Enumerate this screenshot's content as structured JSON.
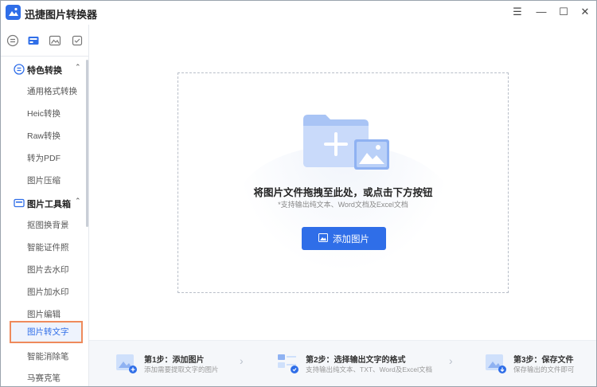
{
  "app": {
    "title": "迅捷图片转换器"
  },
  "window_controls": {
    "menu": "☰",
    "minimize": "—",
    "maximize": "☐",
    "close": "✕"
  },
  "sidebar": {
    "groups": [
      {
        "label": "特色转换",
        "icon": "special-convert-icon",
        "items": [
          "通用格式转换",
          "Heic转换",
          "Raw转换",
          "转为PDF",
          "图片压缩"
        ]
      },
      {
        "label": "图片工具箱",
        "icon": "toolbox-icon",
        "items": [
          "抠图换背景",
          "智能证件照",
          "图片去水印",
          "图片加水印",
          "图片编辑",
          "图片转文字",
          "智能消除笔",
          "马赛克笔"
        ]
      }
    ],
    "active_item": "图片转文字",
    "caret": "⌃"
  },
  "dropzone": {
    "title": "将图片文件拖拽至此处，或点击下方按钮",
    "subtitle": "*支持输出纯文本、Word文档及Excel文档",
    "button_label": "添加图片",
    "illustration": "folder-add-image-icon"
  },
  "steps": [
    {
      "title": "第1步：添加图片",
      "desc": "添加需要提取文字的图片",
      "icon": "add-image-step-icon"
    },
    {
      "title": "第2步：选择输出文字的格式",
      "desc": "支持输出纯文本、TXT、Word及Excel文档",
      "icon": "format-step-icon"
    },
    {
      "title": "第3步：保存文件",
      "desc": "保存输出的文件即可",
      "icon": "save-step-icon"
    }
  ],
  "step_arrow": "›",
  "colors": {
    "accent": "#2f6ee8",
    "highlight_border": "#ef8a5b"
  }
}
